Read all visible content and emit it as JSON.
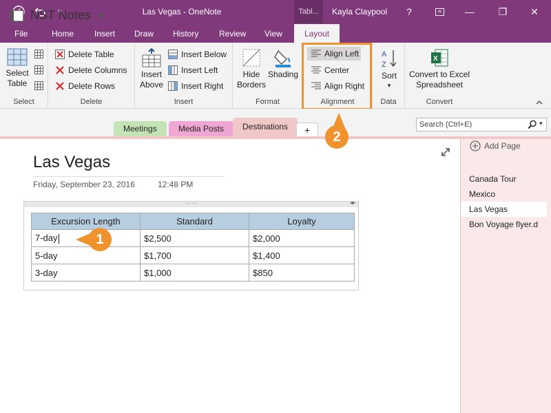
{
  "window": {
    "title": "Las Vegas - OneNote",
    "context_tab": "Tabl...",
    "user": "Kayla Claypool",
    "help": "?",
    "minimize": "—",
    "maximize": "❐",
    "close": "✕"
  },
  "menu_tabs": [
    "File",
    "Home",
    "Insert",
    "Draw",
    "History",
    "Review",
    "View",
    "Layout"
  ],
  "ribbon": {
    "select": {
      "button": "Select Table",
      "label": "Select"
    },
    "delete": {
      "table": "Delete Table",
      "columns": "Delete Columns",
      "rows": "Delete Rows",
      "label": "Delete"
    },
    "insert": {
      "above": "Insert Above",
      "below": "Insert Below",
      "left": "Insert Left",
      "right": "Insert Right",
      "label": "Insert"
    },
    "format": {
      "hide_borders": "Hide Borders",
      "shading": "Shading",
      "label": "Format"
    },
    "alignment": {
      "left": "Align Left",
      "center": "Center",
      "right": "Align Right",
      "label": "Alignment"
    },
    "data": {
      "sort": "Sort",
      "label": "Data"
    },
    "convert": {
      "button": "Convert to Excel Spreadsheet",
      "label": "Convert"
    }
  },
  "notebook": {
    "name": "NST Notes",
    "sections": [
      {
        "label": "Meetings",
        "color": "#c5e4b5"
      },
      {
        "label": "Media Posts",
        "color": "#efa6d2"
      },
      {
        "label": "Destinations",
        "color": "#f1c8c9"
      }
    ],
    "add_section": "+",
    "search_placeholder": "Search (Ctrl+E)"
  },
  "page": {
    "title": "Las Vegas",
    "date": "Friday, September 23, 2016",
    "time": "12:48 PM"
  },
  "table": {
    "headers": [
      "Excursion Length",
      "Standard",
      "Loyalty"
    ],
    "rows": [
      [
        "7-day",
        "$2,500",
        "$2,000"
      ],
      [
        "5-day",
        "$1,700",
        "$1,400"
      ],
      [
        "3-day",
        "$1,000",
        "$850"
      ]
    ]
  },
  "page_list": {
    "add_page": "Add Page",
    "items": [
      "Canada Tour",
      "Mexico",
      "Las Vegas",
      "Bon Voyage flyer.d"
    ]
  },
  "callouts": [
    "1",
    "2"
  ],
  "colors": {
    "accent": "#80397b",
    "callout": "#f0922e",
    "table_header": "#b7cde0"
  }
}
